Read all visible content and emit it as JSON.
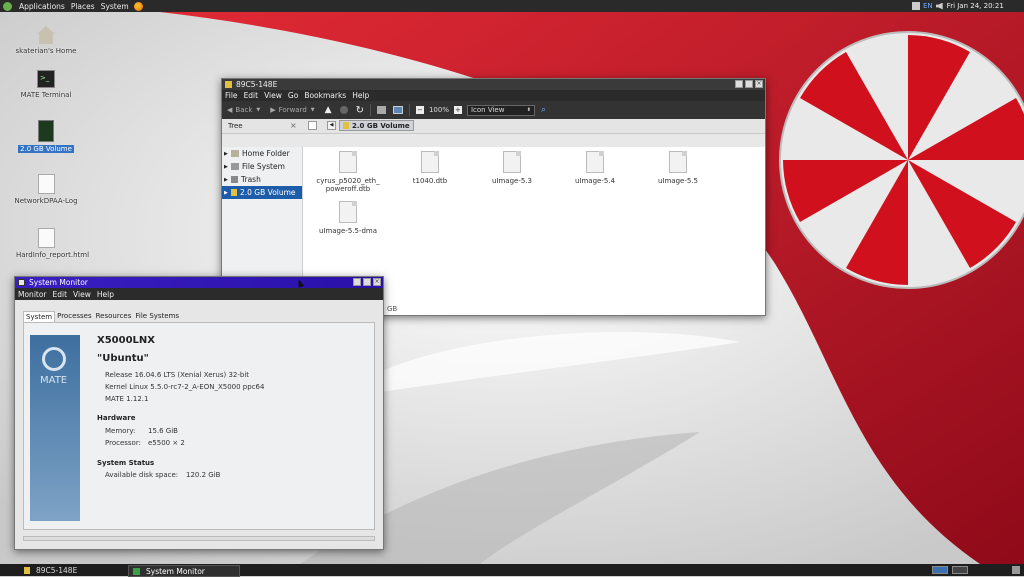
{
  "top_panel": {
    "menus": [
      "Applications",
      "Places",
      "System"
    ],
    "keyboard_layout": "EN",
    "clock": "Fri Jan 24, 20:21"
  },
  "desktop_icons": [
    {
      "label": "skaterian's Home",
      "icon": "home-folder-icon"
    },
    {
      "label": "MATE Terminal",
      "icon": "terminal-icon"
    },
    {
      "label": "2.0 GB Volume",
      "icon": "volume-icon"
    },
    {
      "label": "NetworkDPAA-Log",
      "icon": "text-file-icon"
    },
    {
      "label": "HardInfo_report.html",
      "icon": "html-file-icon"
    }
  ],
  "file_manager": {
    "title": "89C5-148E",
    "menu": [
      "File",
      "Edit",
      "View",
      "Go",
      "Bookmarks",
      "Help"
    ],
    "toolbar": {
      "back": "Back",
      "forward": "Forward",
      "zoom": "100%",
      "view": "Icon View"
    },
    "sidebar_header": "Tree",
    "location": "2.0 GB Volume",
    "tree": [
      {
        "label": "Home Folder",
        "icon": "folder-icon",
        "selected": false
      },
      {
        "label": "File System",
        "icon": "drive-icon",
        "selected": false
      },
      {
        "label": "Trash",
        "icon": "trash-icon",
        "selected": false
      },
      {
        "label": "2.0 GB Volume",
        "icon": "volume-icon",
        "selected": true
      }
    ],
    "files": [
      {
        "name": "cyrus_p5020_eth_poweroff.dtb"
      },
      {
        "name": "t1040.dtb"
      },
      {
        "name": "uImage-5.3"
      },
      {
        "name": "uImage-5.4"
      },
      {
        "name": "uImage-5.5"
      },
      {
        "name": "uImage-5.5-dma"
      }
    ],
    "status_fragment": "GB"
  },
  "system_monitor": {
    "title": "System Monitor",
    "menu": [
      "Monitor",
      "Edit",
      "View",
      "Help"
    ],
    "tabs": [
      "System",
      "Processes",
      "Resources",
      "File Systems"
    ],
    "logo_text": "MATE",
    "hostname": "X5000LNX",
    "distro": "\"Ubuntu\"",
    "release": "Release 16.04.6 LTS (Xenial Xerus) 32-bit",
    "kernel": "Kernel Linux 5.5.0-rc7-2_A-EON_X5000 ppc64",
    "mate_version": "MATE 1.12.1",
    "hardware_heading": "Hardware",
    "memory_label": "Memory:",
    "memory_value": "15.6 GiB",
    "processor_label": "Processor:",
    "processor_value": "e5500 × 2",
    "status_heading": "System Status",
    "disk_label": "Available disk space:",
    "disk_value": "120.2 GiB"
  },
  "taskbar": [
    {
      "label": "89C5-148E",
      "active": false
    },
    {
      "label": "System Monitor",
      "active": true
    }
  ],
  "colors": {
    "accent_blue": "#1d5ca8",
    "monitor_title": "#3a1fc2",
    "wallpaper_red": "#c41020"
  }
}
